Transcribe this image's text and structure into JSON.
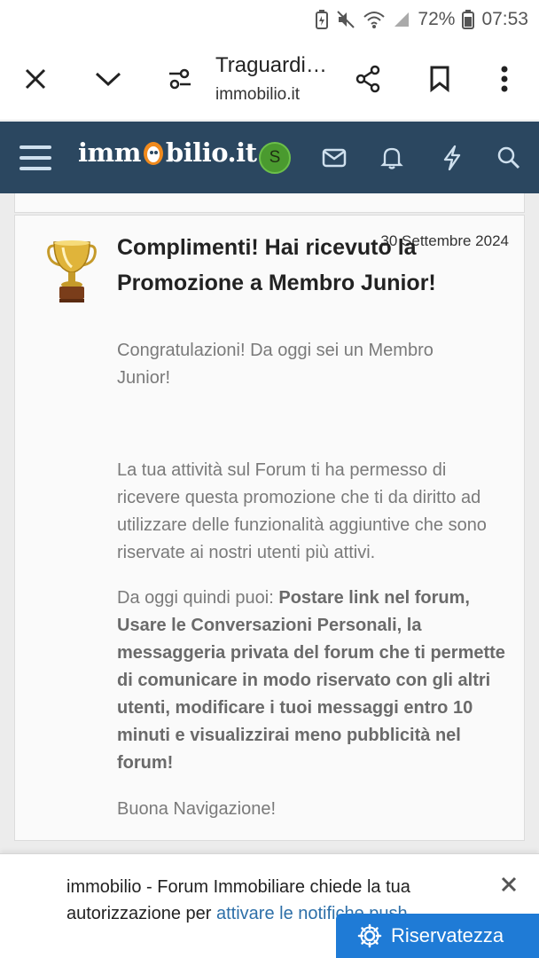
{
  "status_bar": {
    "battery": "72%",
    "time": "07:53"
  },
  "browser": {
    "title": "Traguardi…",
    "url": "immobilio.it"
  },
  "site": {
    "logo_prefix": "imm",
    "logo_suffix": "bilio.it",
    "avatar_letter": "S",
    "brand_color": "#2b4760"
  },
  "notification": {
    "date": "30 Settembre 2024",
    "title": "Complimenti! Hai ricevuto la Promozione a Membro Junior!",
    "subtitle": "Congratulazioni! Da oggi sei un Membro Junior!",
    "para1": "La tua attività sul Forum ti ha permesso di ricevere questa promozione che ti da diritto ad utilizzare delle funzionalità aggiuntive che sono riservate ai nostri utenti più attivi.",
    "para2_prefix": "Da oggi quindi puoi: ",
    "para2_bold": "Postare link nel forum, Usare le Conversazioni Personali, la messaggeria privata del forum che ti permette di comunicare in modo riservato con gli altri utenti, modificare i tuoi messaggi entro 10 minuti e visualizzirai meno pubblicità nel forum!",
    "para3": "Buona Navigazione!"
  },
  "push_prompt": {
    "text": "immobilio - Forum Immobiliare chiede la tua autorizzazione per ",
    "link": "attivare le notifiche push"
  },
  "privacy_button": "Riservatezza"
}
